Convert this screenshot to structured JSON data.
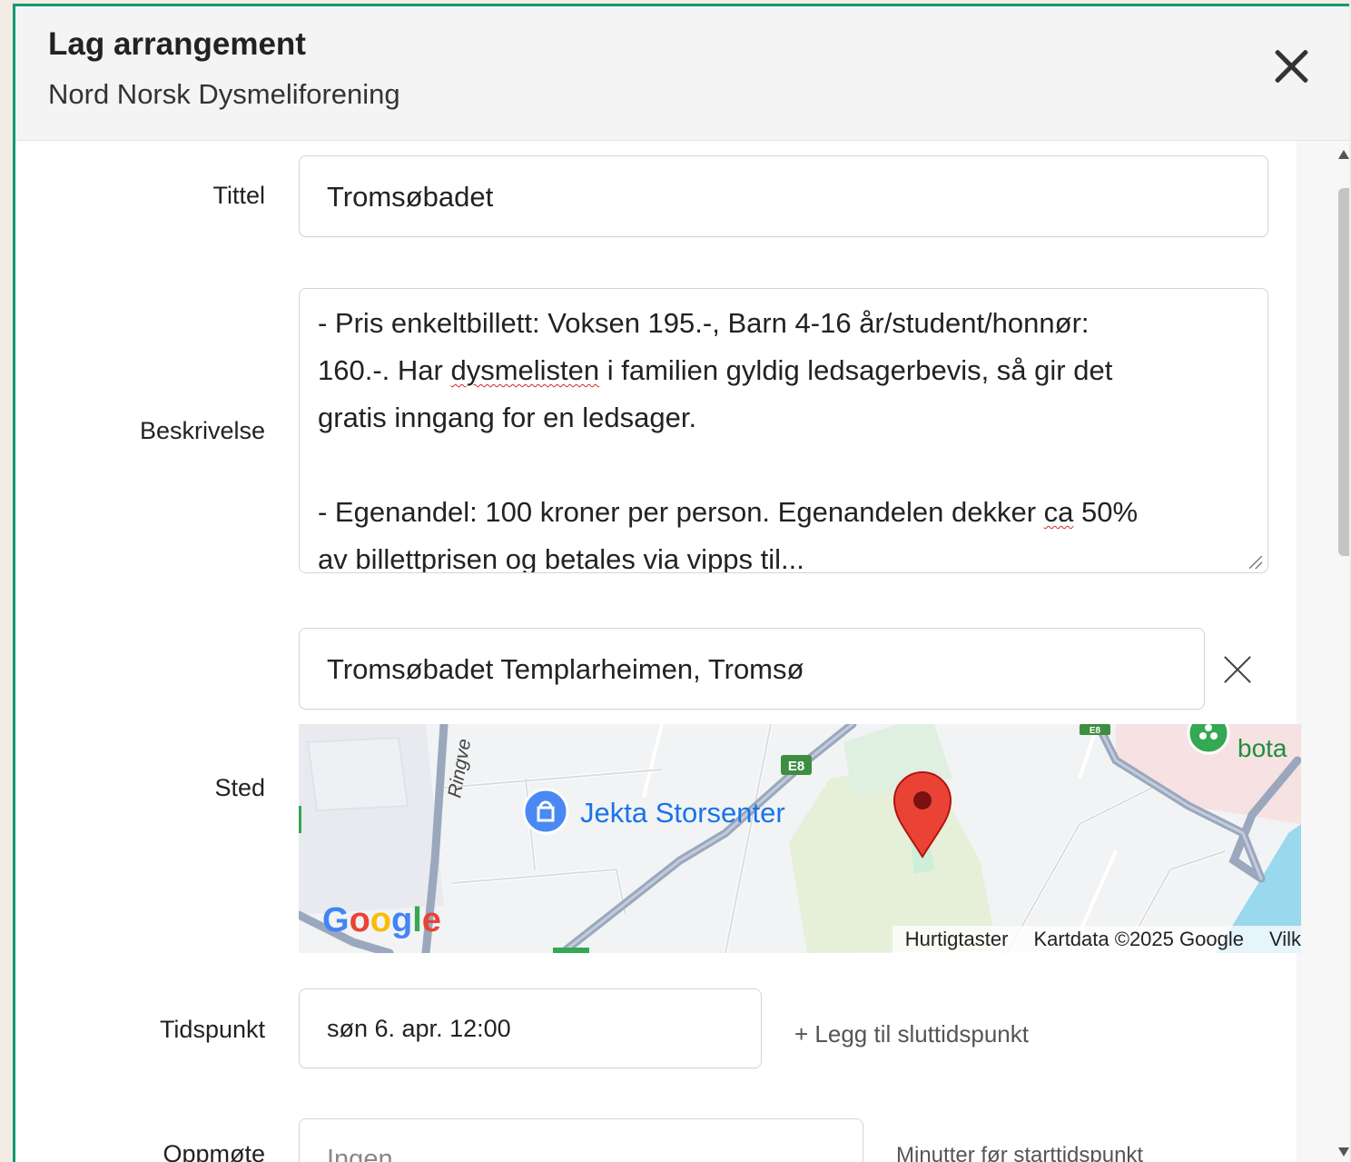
{
  "dialog": {
    "title": "Lag arrangement",
    "subtitle": "Nord Norsk Dysmeliforening",
    "close_icon": "close-icon"
  },
  "form": {
    "title_label": "Tittel",
    "title_value": "Tromsøbadet",
    "description_label": "Beskrivelse",
    "description_lines": [
      "- Pris enkeltbillett: Voksen 195.-, Barn 4-16 år/student/honnør:",
      "160.-. Har ",
      "dysmelisten",
      " i familien gyldig ledsagerbevis, så gir det",
      "gratis inngang for en ledsager.",
      "- Egenandel: 100 kroner per person. Egenandelen dekker ",
      "ca",
      " 50%",
      "av billettprisen og betales via vipps til..."
    ],
    "place_label": "Sted",
    "place_value": "Tromsøbadet Templarheimen, Tromsø",
    "time_label": "Tidspunkt",
    "time_value": "søn 6. apr. 12:00",
    "add_end_time": "+ Legg til sluttidspunkt",
    "meetup_label": "Oppmøte",
    "meetup_placeholder": "Ingen",
    "meetup_hint": "Minutter før starttidspunkt"
  },
  "map": {
    "poi_label": "Jekta Storsenter",
    "road_label": "Ringve",
    "highway_badge": "E8",
    "highway_badge_top": "E8",
    "partial_label": "bota",
    "google_logo": "Google",
    "footer": {
      "shortcuts": "Hurtigtaster",
      "mapdata": "Kartdata ©2025 Google",
      "terms": "Vilk"
    },
    "colors": {
      "park": "#e6efd8",
      "road": "#9aa7bd",
      "water": "#9ad8ee",
      "pin": "#ea4335",
      "poi": "#4a89f3"
    }
  }
}
